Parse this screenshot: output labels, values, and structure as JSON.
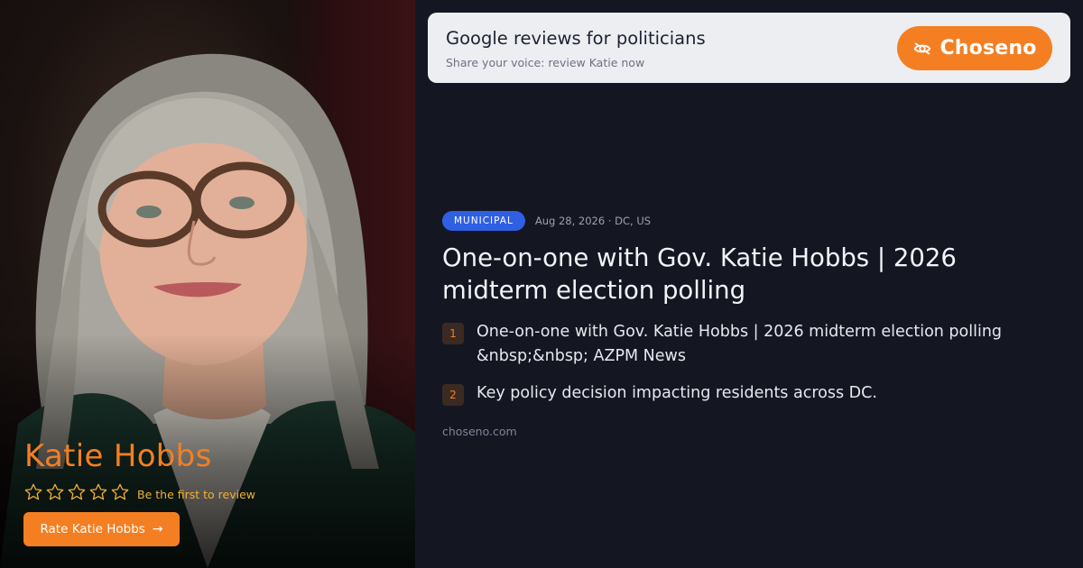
{
  "profile": {
    "name": "Katie Hobbs",
    "stars_total": 5,
    "stars_filled": 0,
    "rating_note": "Be the first to review",
    "rate_button": "Rate Katie Hobbs",
    "rate_arrow": "→"
  },
  "banner": {
    "title": "Google reviews for politicians",
    "subtitle": "Share your voice: review Katie now",
    "brand": "Choseno",
    "brand_icon": "eye-swirl-icon"
  },
  "article": {
    "tag": "MUNICIPAL",
    "meta": "Aug 28, 2026 · DC, US",
    "headline": "One-on-one with Gov. Katie Hobbs | 2026 midterm election polling",
    "points": [
      {
        "num": "1",
        "text": "One-on-one with Gov. Katie Hobbs | 2026 midterm election polling &nbsp;&nbsp; AZPM News"
      },
      {
        "num": "2",
        "text": "Key policy decision impacting residents across DC."
      }
    ],
    "domain": "choseno.com"
  },
  "colors": {
    "accent": "#f47f22",
    "tag_blue": "#2f5fe3",
    "background": "#141722",
    "star_outline": "#f2b134"
  }
}
